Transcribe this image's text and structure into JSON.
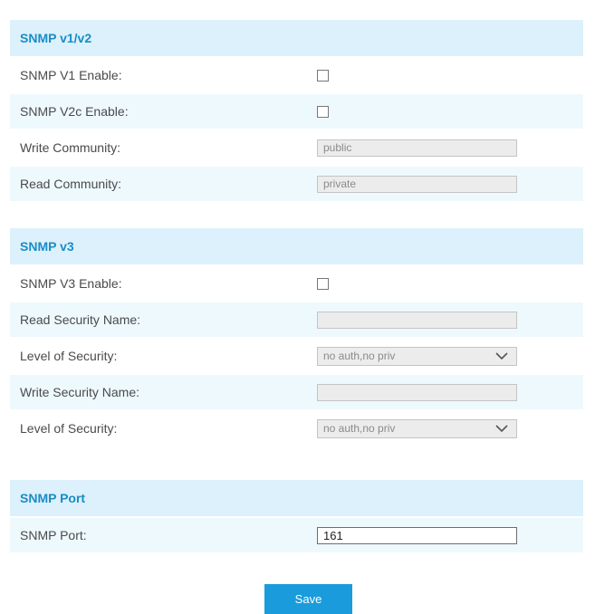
{
  "v12": {
    "title": "SNMP v1/v2",
    "v1_enable_label": "SNMP V1 Enable:",
    "v2c_enable_label": "SNMP V2c Enable:",
    "write_community_label": "Write Community:",
    "write_community_value": "public",
    "read_community_label": "Read Community:",
    "read_community_value": "private"
  },
  "v3": {
    "title": "SNMP v3",
    "v3_enable_label": "SNMP V3 Enable:",
    "read_security_name_label": "Read Security Name:",
    "read_security_name_value": "",
    "read_level_label": "Level of Security:",
    "read_level_value": "no auth,no priv",
    "write_security_name_label": "Write Security Name:",
    "write_security_name_value": "",
    "write_level_label": "Level of Security:",
    "write_level_value": "no auth,no priv"
  },
  "port": {
    "title": "SNMP Port",
    "port_label": "SNMP Port:",
    "port_value": "161"
  },
  "save_label": "Save",
  "colors": {
    "header_bg": "#dcf1fb",
    "header_text": "#1a8cc8",
    "row_alt_bg": "#eef9fe",
    "button_bg": "#1a9cdc"
  }
}
